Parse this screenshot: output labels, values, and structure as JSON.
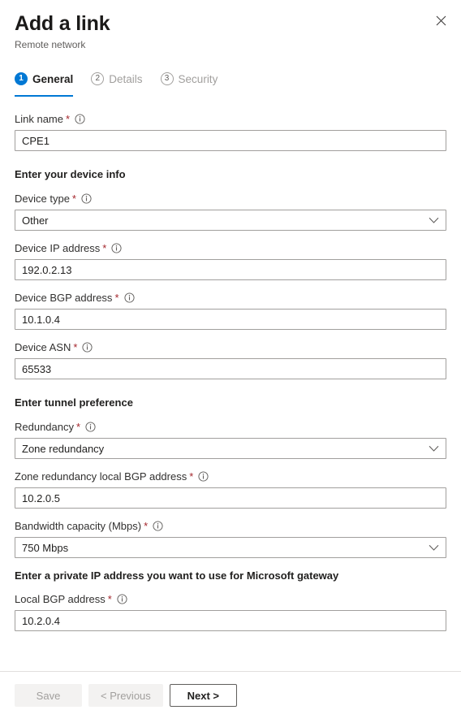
{
  "header": {
    "title": "Add a link",
    "subtitle": "Remote network",
    "close_icon": "close-icon"
  },
  "tabs": [
    {
      "num": "1",
      "label": "General",
      "active": true
    },
    {
      "num": "2",
      "label": "Details",
      "active": false
    },
    {
      "num": "3",
      "label": "Security",
      "active": false
    }
  ],
  "form": {
    "link_name": {
      "label": "Link name",
      "required": "*",
      "info_icon": "info-icon",
      "value": "CPE1"
    },
    "section_device": "Enter your device info",
    "device_type": {
      "label": "Device type",
      "required": "*",
      "info_icon": "info-icon",
      "value": "Other",
      "chevron_icon": "chevron-down-icon"
    },
    "device_ip": {
      "label": "Device IP address",
      "required": "*",
      "info_icon": "info-icon",
      "value": "192.0.2.13"
    },
    "device_bgp": {
      "label": "Device BGP address",
      "required": "*",
      "info_icon": "info-icon",
      "value": "10.1.0.4"
    },
    "device_asn": {
      "label": "Device ASN",
      "required": "*",
      "info_icon": "info-icon",
      "value": "65533"
    },
    "section_tunnel": "Enter tunnel preference",
    "redundancy": {
      "label": "Redundancy",
      "required": "*",
      "info_icon": "info-icon",
      "value": "Zone redundancy",
      "chevron_icon": "chevron-down-icon"
    },
    "zone_bgp": {
      "label": "Zone redundancy local BGP address",
      "required": "*",
      "info_icon": "info-icon",
      "value": "10.2.0.5"
    },
    "bandwidth": {
      "label": "Bandwidth capacity (Mbps)",
      "required": "*",
      "info_icon": "info-icon",
      "value": "750 Mbps",
      "chevron_icon": "chevron-down-icon"
    },
    "section_gateway": "Enter a private IP address you want to use for Microsoft gateway",
    "local_bgp": {
      "label": "Local BGP address",
      "required": "*",
      "info_icon": "info-icon",
      "value": "10.2.0.4"
    }
  },
  "footer": {
    "save_label": "Save",
    "previous_label": "< Previous",
    "next_label": "Next >"
  },
  "colors": {
    "accent": "#0078d4",
    "required_red": "#a4262c",
    "border": "#a19f9d",
    "muted_text": "#605e5c",
    "disabled_bg": "#f3f2f1",
    "disabled_text": "#a19f9d"
  }
}
